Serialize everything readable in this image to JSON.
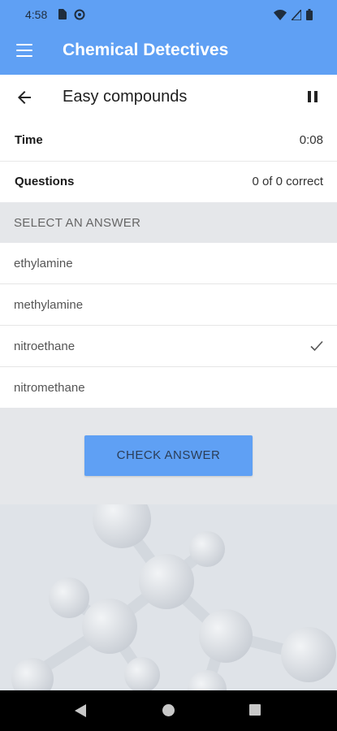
{
  "status_bar": {
    "time": "4:58",
    "icons": [
      "sim-card-icon",
      "at-sign-icon",
      "wifi-icon",
      "signal-icon",
      "battery-icon"
    ]
  },
  "app_bar": {
    "title": "Chemical Detectives",
    "color": "#5fa0f4"
  },
  "sub_bar": {
    "title": "Easy compounds"
  },
  "stats": {
    "time_label": "Time",
    "time_value": "0:08",
    "questions_label": "Questions",
    "questions_value": "0 of 0 correct"
  },
  "answers": {
    "header": "SELECT AN ANSWER",
    "options": [
      "ethylamine",
      "methylamine",
      "nitroethane",
      "nitromethane"
    ],
    "selected": "nitroethane"
  },
  "check_button_label": "CHECK ANSWER",
  "nav_bar": [
    "back-icon",
    "home-icon",
    "recents-icon"
  ]
}
